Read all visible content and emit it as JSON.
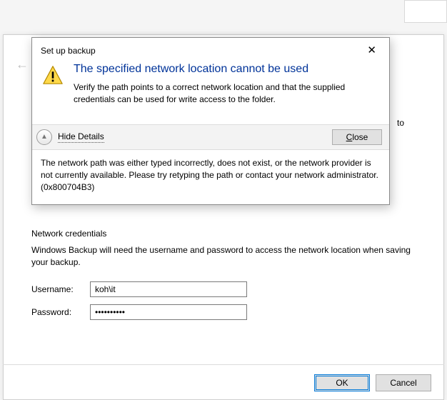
{
  "backdrop": {
    "truncated_text": "to"
  },
  "wizard": {
    "cred_title": "Network credentials",
    "cred_desc": "Windows Backup will need the username and password to access the network location when saving your backup.",
    "username_label": "Username:",
    "password_label": "Password:",
    "username_value": "koh\\it",
    "password_value": "••••••••••",
    "ok_label": "OK",
    "cancel_label": "Cancel"
  },
  "dialog": {
    "title": "Set up backup",
    "heading": "The specified network location cannot be used",
    "instruction": "Verify the path points to a correct network location and that the supplied credentials can be used for write access to the folder.",
    "details_toggle": "Hide Details",
    "close_label_pre": "",
    "close_label_key": "C",
    "close_label_post": "lose",
    "details_text": "The network path was either typed incorrectly, does not exist, or the network provider is not currently available. Please try retyping the path or contact your network administrator. (0x800704B3)"
  }
}
